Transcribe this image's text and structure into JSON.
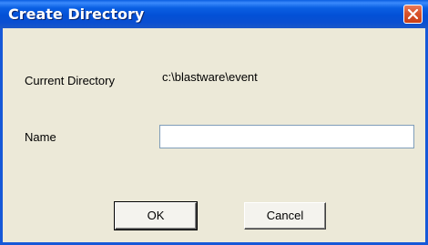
{
  "window": {
    "title": "Create Directory",
    "close_label": "close"
  },
  "form": {
    "current_directory_label": "Current Directory",
    "current_directory_value": "c:\\blastware\\event",
    "name_label": "Name",
    "name_value": "",
    "name_placeholder": ""
  },
  "buttons": {
    "ok_label": "OK",
    "cancel_label": "Cancel"
  },
  "colors": {
    "titlebar": "#0350d6",
    "dialog_bg": "#ece9d8",
    "close_button": "#d9542c"
  },
  "icons": {
    "close": "close-icon"
  }
}
